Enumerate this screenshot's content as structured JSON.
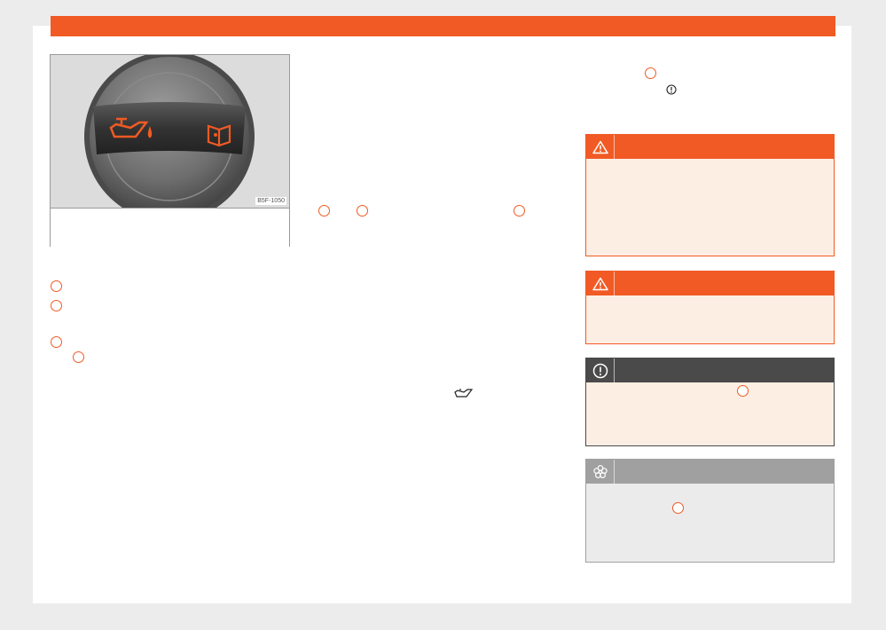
{
  "figure": {
    "code": "B5F-1050",
    "image_icon": "oil-filler-cap-image"
  },
  "colors": {
    "accent": "#f15a24",
    "note_dark": "#4a4a4a",
    "env_grey": "#a0a0a0",
    "box_fill": "#fdeee3"
  },
  "boxes": {
    "warning_1_icon": "warning-triangle-icon",
    "warning_2_icon": "warning-triangle-icon",
    "note_icon": "exclamation-circle-icon",
    "environment_icon": "flower-icon"
  }
}
